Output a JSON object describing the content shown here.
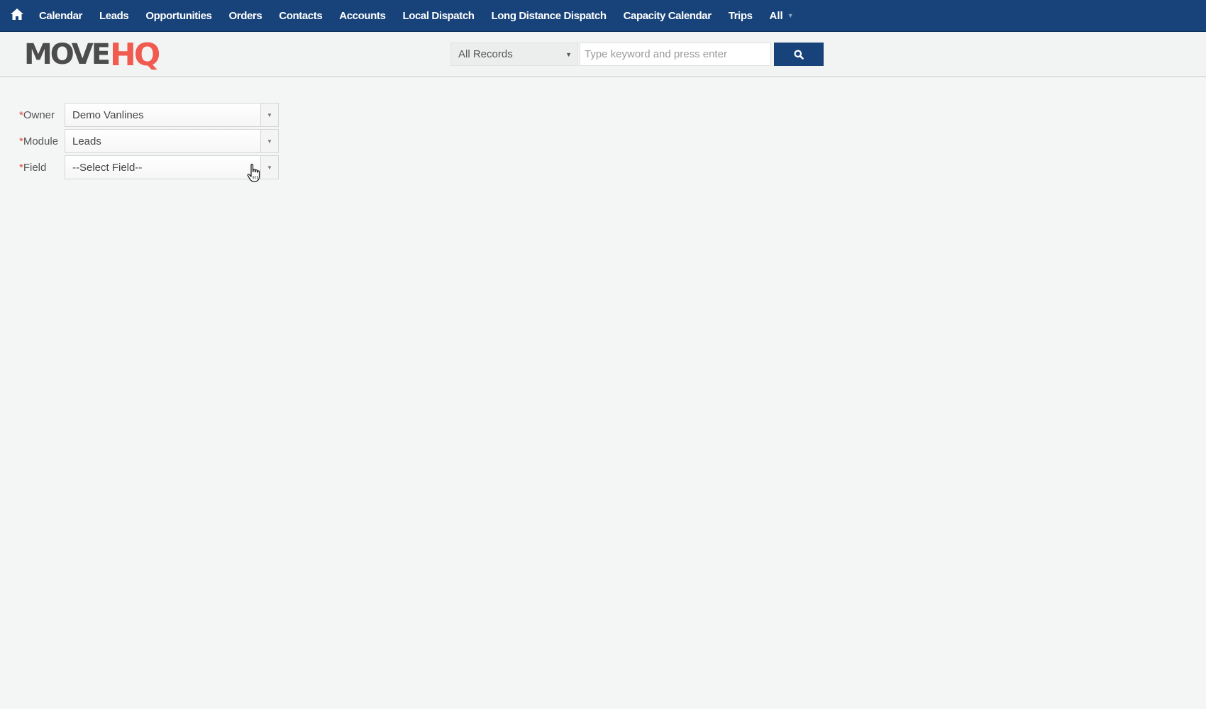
{
  "nav": {
    "home_icon": "home-icon",
    "items": [
      {
        "label": "Calendar"
      },
      {
        "label": "Leads"
      },
      {
        "label": "Opportunities"
      },
      {
        "label": "Orders"
      },
      {
        "label": "Contacts"
      },
      {
        "label": "Accounts"
      },
      {
        "label": "Local Dispatch"
      },
      {
        "label": "Long Distance Dispatch"
      },
      {
        "label": "Capacity Calendar"
      },
      {
        "label": "Trips"
      }
    ],
    "all_label": "All",
    "background": "#17437a"
  },
  "header": {
    "logo": {
      "move": "MOVE",
      "hq": "HQ",
      "move_color": "#4c4c4c",
      "hq_color": "#f05a4f"
    },
    "search": {
      "scope_value": "All Records",
      "placeholder": "Type keyword and press enter",
      "button_icon": "search-icon"
    }
  },
  "form": {
    "required_marker": "*",
    "fields": [
      {
        "label": "Owner",
        "value": "Demo Vanlines"
      },
      {
        "label": "Module",
        "value": "Leads"
      },
      {
        "label": "Field",
        "value": "--Select Field--"
      }
    ]
  }
}
